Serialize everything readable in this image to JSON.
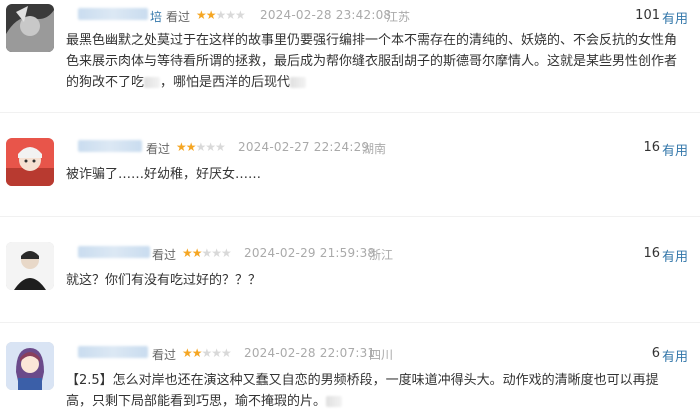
{
  "comments": [
    {
      "user_suffix": "培",
      "watched": "看过",
      "rating": 2,
      "time": "2024-02-28 23:42:08",
      "location": "江苏",
      "useful_count": "101",
      "useful_label": "有用",
      "text_line1": "最黑色幽默之处莫过于在这样的故事里仍要强行编排一个本不需存在的清纯的、妖娆的、不会反抗的女性角",
      "text_line2": "色来展示肉体与等待看所谓的拯救，最后成为帮你缝衣服刮胡子的斯德哥尔摩情人。这就是某些男性创作者",
      "text_line3a": "的狗改不了吃",
      "text_line3b": "，哪怕是西洋的后现代",
      "text_line3c": "。"
    },
    {
      "watched": "看过",
      "rating": 2,
      "time": "2024-02-27 22:24:29",
      "location": "湖南",
      "useful_count": "16",
      "useful_label": "有用",
      "text_line1": "被诈骗了……好幼稚，好厌女……"
    },
    {
      "watched": "看过",
      "rating": 2,
      "time": "2024-02-29 21:59:38",
      "location": "浙江",
      "useful_count": "16",
      "useful_label": "有用",
      "text_line1": "就这？你们有没有吃过好的？？？"
    },
    {
      "watched": "看过",
      "rating": 2,
      "time": "2024-02-28 22:07:31",
      "location": "四川",
      "useful_count": "6",
      "useful_label": "有用",
      "text_line1": "【2.5】怎么对岸也还在演这种又蠢又自恋的男频桥段，一度味道冲得头大。动作戏的清晰度也可以再提",
      "text_line2": "高，只剩下局部能看到巧思，瑜不掩瑕的片。"
    }
  ]
}
